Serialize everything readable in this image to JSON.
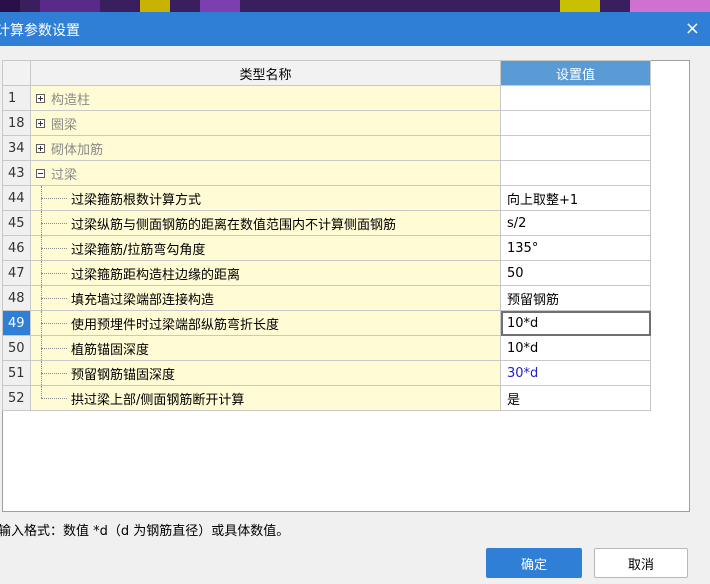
{
  "window": {
    "title": "计算参数设置",
    "close_glyph": "×"
  },
  "grid": {
    "headers": {
      "name": "类型名称",
      "value": "设置值"
    },
    "rows": [
      {
        "num": "1",
        "kind": "category",
        "expanded": false,
        "name": "构造柱",
        "value": ""
      },
      {
        "num": "18",
        "kind": "category",
        "expanded": false,
        "name": "圈梁",
        "value": ""
      },
      {
        "num": "34",
        "kind": "category",
        "expanded": false,
        "name": "砌体加筋",
        "value": ""
      },
      {
        "num": "43",
        "kind": "category",
        "expanded": true,
        "name": "过梁",
        "value": ""
      },
      {
        "num": "44",
        "kind": "child",
        "name": "过梁箍筋根数计算方式",
        "value": "向上取整+1"
      },
      {
        "num": "45",
        "kind": "child",
        "name": "过梁纵筋与侧面钢筋的距离在数值范围内不计算侧面钢筋",
        "value": "s/2"
      },
      {
        "num": "46",
        "kind": "child",
        "name": "过梁箍筋/拉筋弯勾角度",
        "value": "135°"
      },
      {
        "num": "47",
        "kind": "child",
        "name": "过梁箍筋距构造柱边缘的距离",
        "value": "50"
      },
      {
        "num": "48",
        "kind": "child",
        "name": "填充墙过梁端部连接构造",
        "value": "预留钢筋"
      },
      {
        "num": "49",
        "kind": "child",
        "name": "使用预埋件时过梁端部纵筋弯折长度",
        "value": "10*d",
        "selected": true
      },
      {
        "num": "50",
        "kind": "child",
        "name": "植筋锚固深度",
        "value": "10*d"
      },
      {
        "num": "51",
        "kind": "child",
        "name": "预留钢筋锚固深度",
        "value": "30*d",
        "value_color": "#2222cc"
      },
      {
        "num": "52",
        "kind": "child",
        "name": "拱过梁上部/侧面钢筋断开计算",
        "value": "是",
        "last": true
      }
    ]
  },
  "hint": "输入格式：数值 *d（d 为钢筋直径）或具体数值。",
  "buttons": {
    "ok": "确定",
    "cancel": "取消"
  },
  "colors": {
    "titlebar": "#2f7fd6",
    "header_value": "#5b9bd5",
    "name_cell": "#fffbd4",
    "selected_row": "#2f7fd6"
  },
  "icons": {
    "expand": "plus-box-icon",
    "collapse": "minus-box-icon",
    "close": "close-icon"
  }
}
